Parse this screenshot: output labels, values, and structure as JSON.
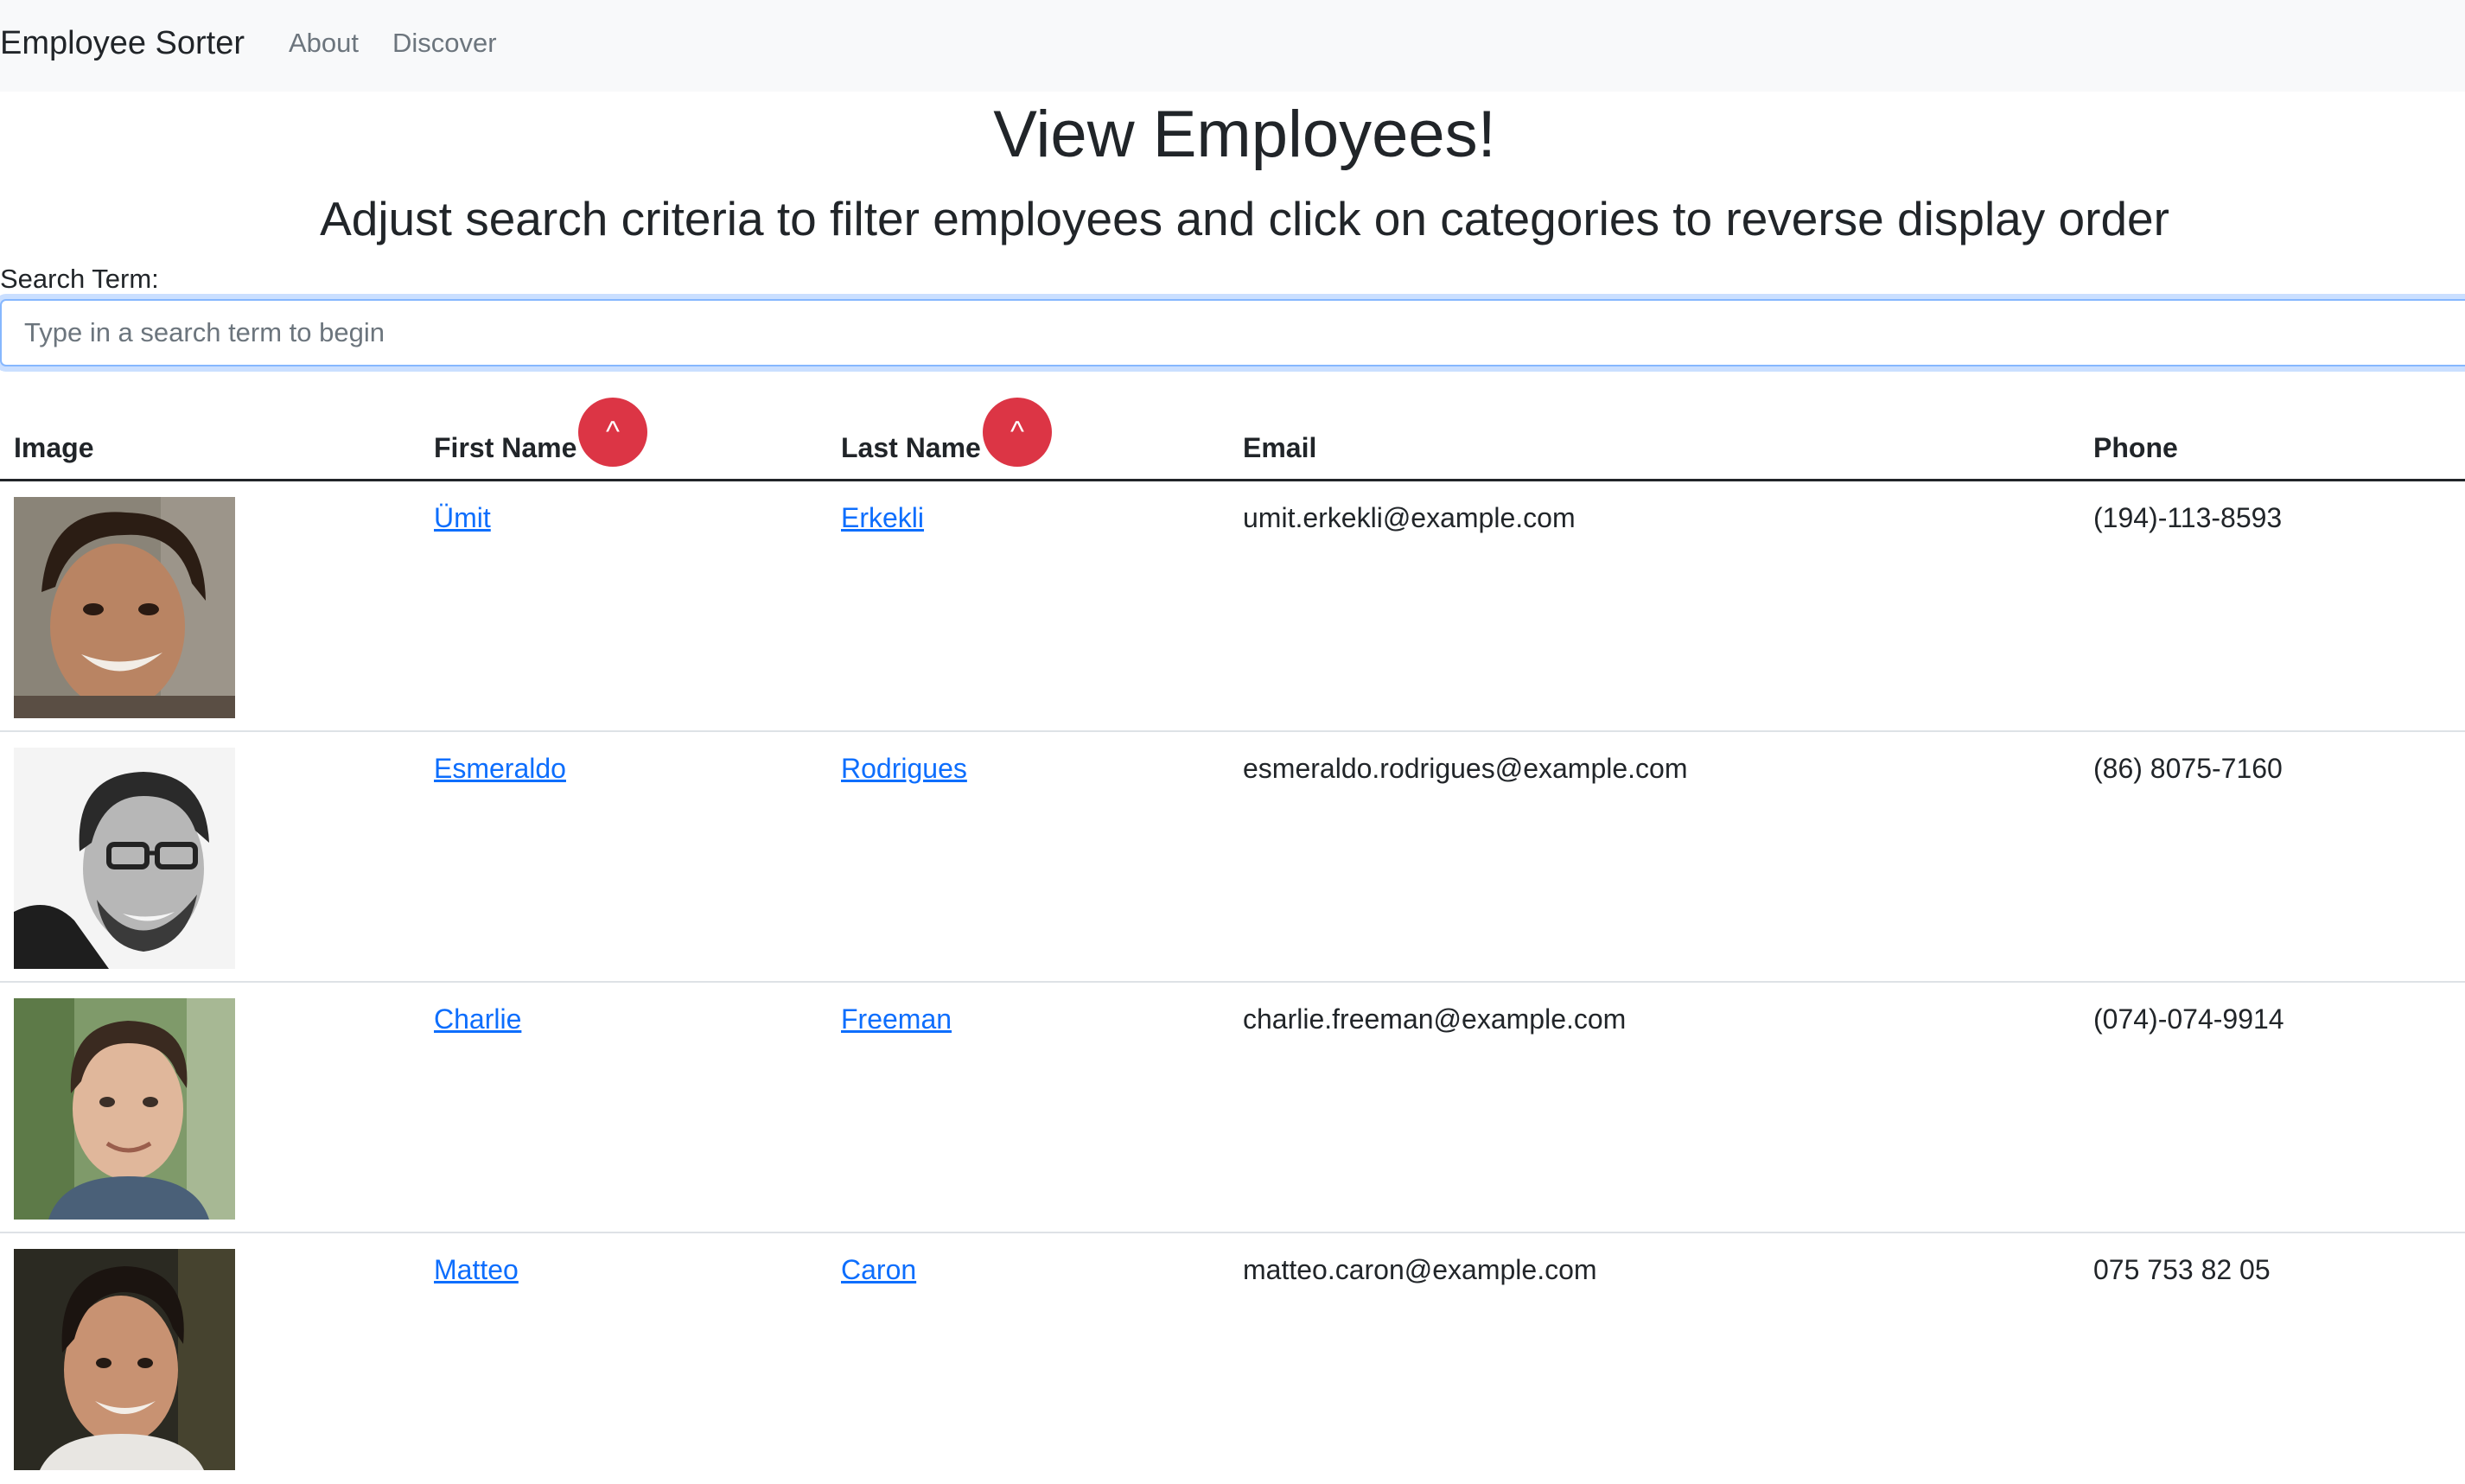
{
  "navbar": {
    "brand": "Employee Sorter",
    "links": [
      "About",
      "Discover"
    ]
  },
  "header": {
    "title": "View Employees!",
    "subtitle": "Adjust search criteria to filter employees and click on categories to reverse display order"
  },
  "search": {
    "label": "Search Term:",
    "value": "",
    "placeholder": "Type in a search term to begin"
  },
  "table": {
    "columns": [
      "Image",
      "First Name",
      "Last Name",
      "Email",
      "Phone"
    ],
    "sort_glyph": "^",
    "rows": [
      {
        "first": "Ümit",
        "last": "Erkekli",
        "email": "umit.erkekli@example.com",
        "phone": "(194)-113-8593"
      },
      {
        "first": "Esmeraldo",
        "last": "Rodrigues",
        "email": "esmeraldo.rodrigues@example.com",
        "phone": "(86) 8075-7160"
      },
      {
        "first": "Charlie",
        "last": "Freeman",
        "email": "charlie.freeman@example.com",
        "phone": "(074)-074-9914"
      },
      {
        "first": "Matteo",
        "last": "Caron",
        "email": "matteo.caron@example.com",
        "phone": "075 753 82 05"
      }
    ]
  },
  "colors": {
    "navbar_bg": "#f8f9fa",
    "link": "#0d6efd",
    "sort_button": "#dc3545",
    "text": "#212529"
  }
}
